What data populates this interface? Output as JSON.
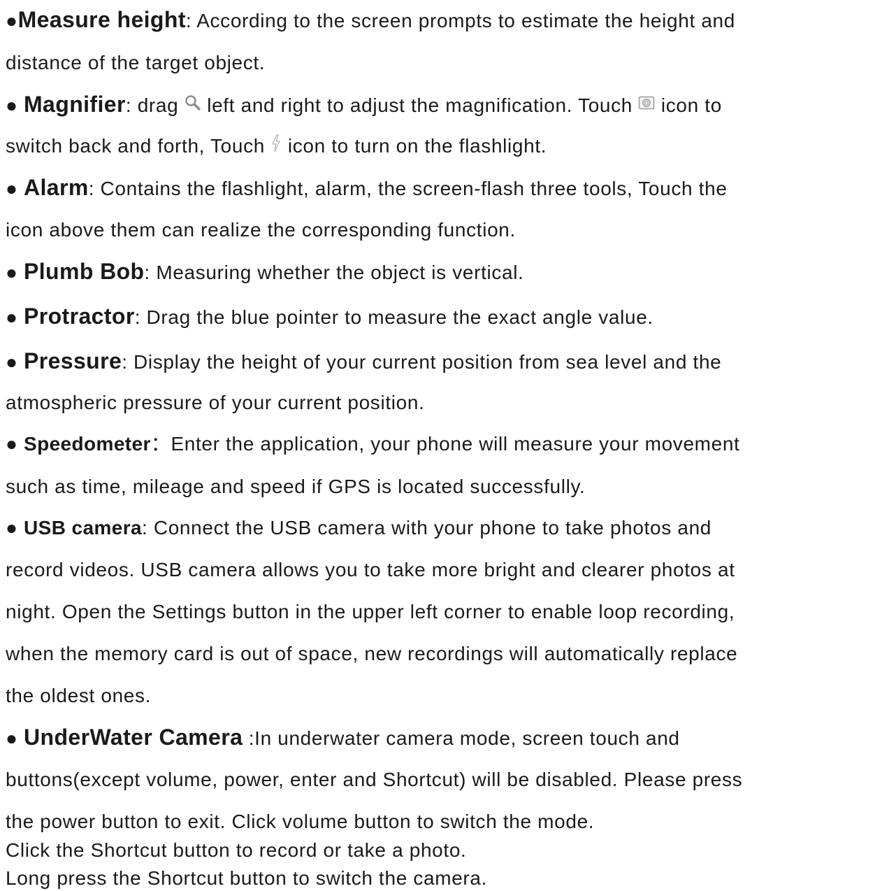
{
  "items": [
    {
      "bullet": "●",
      "term": "Measure height",
      "lines": [
        ": According to the screen prompts to estimate the height and",
        "distance of the target object."
      ]
    },
    {
      "bullet": "● ",
      "term": "Magnifier",
      "line1_a": ": drag ",
      "line1_b": " left and right to adjust the magnification. Touch ",
      "line1_c": " icon to",
      "line2_a": "switch back and forth, Touch ",
      "line2_b": "  icon to turn on the flashlight.",
      "icons": [
        "search-icon",
        "camera-icon",
        "flash-icon"
      ]
    },
    {
      "bullet": "● ",
      "term": "Alarm",
      "lines": [
        ": Contains the flashlight, alarm, the screen-flash three tools, Touch the",
        "icon above them can realize the corresponding function."
      ]
    },
    {
      "bullet": "● ",
      "term": "Plumb Bob",
      "lines": [
        ": Measuring whether the object is vertical."
      ]
    },
    {
      "bullet": "● ",
      "term": "Protractor",
      "lines": [
        ": Drag the blue pointer to measure the exact angle value."
      ]
    },
    {
      "bullet": "● ",
      "term": "Pressure",
      "lines": [
        ": Display the height of your current position from sea level and the",
        "atmospheric pressure of your current position."
      ]
    },
    {
      "bullet": "● ",
      "term": "Speedometer",
      "lines": [
        "：Enter the application, your phone will measure your movement",
        "such as time, mileage and speed if GPS is located successfully."
      ]
    },
    {
      "bullet": "● ",
      "term": "USB camera",
      "lines": [
        ": Connect the USB camera with your phone to take photos and",
        "record videos. USB camera allows you to take more bright and clearer photos at",
        "night. Open the Settings button in the upper left corner to enable loop recording,",
        "when the memory card is out of space, new recordings will automatically replace",
        "the oldest ones."
      ]
    },
    {
      "bullet": "● ",
      "term": "UnderWater Camera",
      "lines": [
        " :In underwater camera mode, screen touch and",
        "buttons(except volume, power, enter and Shortcut) will be disabled. Please press",
        "the power button to exit. Click volume button to switch the mode.",
        "Click the Shortcut button to record or take a photo.",
        "Long press the Shortcut button to switch the camera."
      ]
    }
  ]
}
